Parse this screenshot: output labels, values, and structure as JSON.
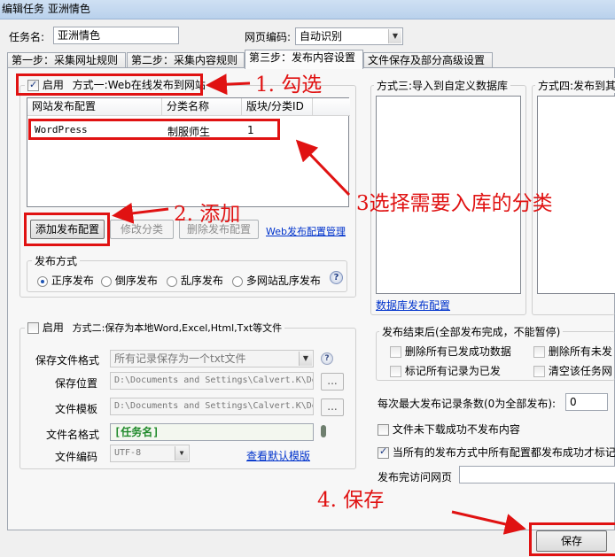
{
  "window": {
    "title": "编辑任务 亚洲情色"
  },
  "header": {
    "task_name_label": "任务名:",
    "task_name_value": "亚洲情色",
    "encoding_label": "网页编码:",
    "encoding_value": "自动识别"
  },
  "tabs": [
    {
      "label": "第一步：采集网址规则"
    },
    {
      "label": "第二步：采集内容规则"
    },
    {
      "label": "第三步：发布内容设置"
    },
    {
      "label": "文件保存及部分高级设置"
    }
  ],
  "method1": {
    "enable_label": "启用",
    "title": "方式一:Web在线发布到网站",
    "columns": [
      "网站发布配置",
      "分类名称",
      "版块/分类ID"
    ],
    "rows": [
      {
        "site": "WordPress",
        "category": "制服师生",
        "id": "1"
      }
    ],
    "add_button": "添加发布配置",
    "edit_button": "修改分类",
    "delete_button": "删除发布配置",
    "manage_link": "Web发布配置管理",
    "publish_mode_label": "发布方式",
    "radio_options": [
      "正序发布",
      "倒序发布",
      "乱序发布",
      "多网站乱序发布"
    ],
    "help_icon": "?"
  },
  "method2": {
    "enable_label": "启用",
    "title": "方式二:保存为本地Word,Excel,Html,Txt等文件",
    "format_label": "保存文件格式",
    "format_value": "所有记录保存为一个txt文件",
    "location_label": "保存位置",
    "location_value": "D:\\Documents and Settings\\Calvert.K\\De",
    "template_label": "文件模板",
    "template_value": "D:\\Documents and Settings\\Calvert.K\\De",
    "filename_label": "文件名格式",
    "filename_value": "[任务名]",
    "encoding_label": "文件编码",
    "encoding_value": "UTF-8",
    "default_template_link": "查看默认模版",
    "browse_label": "..."
  },
  "method3": {
    "title": "方式三:导入到自定义数据库",
    "link": "数据库发布配置"
  },
  "method4": {
    "title": "方式四:发布到其"
  },
  "after_publish": {
    "title": "发布结束后(全部发布完成，不能暂停)",
    "opt1": "删除所有已发成功数据",
    "opt2": "删除所有未发",
    "opt3": "标记所有记录为已发",
    "opt4": "清空该任务网"
  },
  "settings": {
    "max_records_label": "每次最大发布记录条数(0为全部发布):",
    "max_records_value": "0",
    "file_not_downloaded_label": "文件未下载成功不发布内容",
    "mark_all_label": "当所有的发布方式中所有配置都发布成功才标记",
    "visit_url_label": "发布完访问网页",
    "visit_url_value": ""
  },
  "save_button": "保存",
  "annotations": {
    "step1": "1. 勾选",
    "step2": "2. 添加",
    "step3": "3选择需要入库的分类",
    "step4": "4. 保存"
  },
  "colors": {
    "annotation_red": "#e01212",
    "link_blue": "#0033cc",
    "title_bar": "#b9d1ec"
  }
}
